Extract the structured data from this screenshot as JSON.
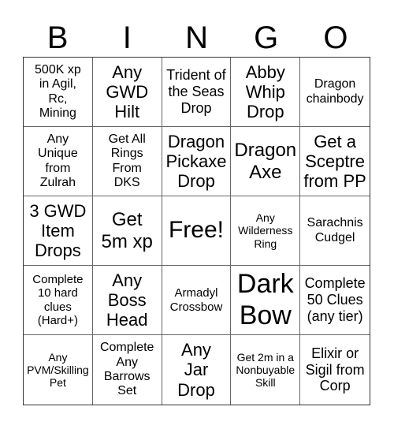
{
  "header": {
    "letters": [
      "B",
      "I",
      "N",
      "G",
      "O"
    ]
  },
  "cells": [
    "500K xp\nin Agil,\nRc,\nMining",
    "Any\nGWD\nHilt",
    "Trident of\nthe Seas\nDrop",
    "Abby\nWhip\nDrop",
    "Dragon\nchainbody",
    "Any\nUnique\nfrom\nZulrah",
    "Get All\nRings\nFrom\nDKS",
    "Dragon\nPickaxe\nDrop",
    "Dragon\nAxe",
    "Get a\nSceptre\nfrom PP",
    "3 GWD\nItem\nDrops",
    "Get\n5m xp",
    "Free!",
    "Any\nWilderness\nRing",
    "Sarachnis\nCudgel",
    "Complete\n10 hard\nclues\n(Hard+)",
    "Any\nBoss\nHead",
    "Armadyl\nCrossbow",
    "Dark\nBow",
    "Complete\n50 Clues\n(any tier)",
    "Any\nPVM/Skilling\nPet",
    "Complete\nAny\nBarrows\nSet",
    "Any\nJar\nDrop",
    "Get 2m in a\nNonbuyable\nSkill",
    "Elixir or\nSigil from\nCorp"
  ]
}
